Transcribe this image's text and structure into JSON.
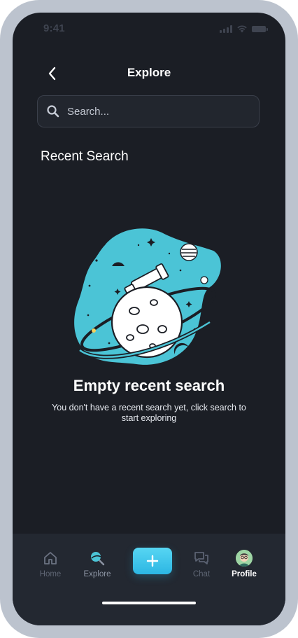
{
  "status_bar": {
    "time": "9:41",
    "icons": [
      "signal-icon",
      "wifi-icon",
      "battery-icon"
    ]
  },
  "header": {
    "title": "Explore",
    "back_icon": "chevron-left-icon"
  },
  "search": {
    "placeholder": "Search...",
    "value": "",
    "icon": "search-icon"
  },
  "recent": {
    "title": "Recent Search"
  },
  "empty_state": {
    "illustration": "planet-telescope-illustration",
    "title": "Empty recent search",
    "message": "You don't have a recent search yet, click search to start exploring"
  },
  "tab_bar": {
    "items": [
      {
        "label": "Home",
        "icon": "home-icon"
      },
      {
        "label": "Explore",
        "icon": "explore-icon",
        "active": true
      },
      {
        "label": "",
        "icon": "plus-icon"
      },
      {
        "label": "Chat",
        "icon": "chat-icon"
      },
      {
        "label": "Profile",
        "icon": "avatar"
      }
    ]
  },
  "colors": {
    "background": "#1b1e25",
    "accent": "#2cb6e3",
    "tab_bar": "#232831",
    "frame": "#bcc3ce"
  }
}
